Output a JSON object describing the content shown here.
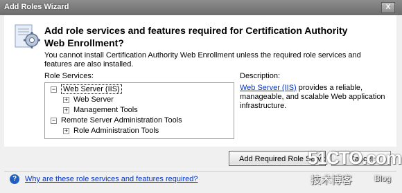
{
  "window": {
    "title": "Add Roles Wizard",
    "close_glyph": "X"
  },
  "header": {
    "icon": "wizard-gear-icon",
    "heading": "Add role services and features required for Certification Authority Web Enrollment?"
  },
  "intro_text": "You cannot install Certification Authority Web Enrollment unless the required role services and features are also installed.",
  "role_services": {
    "label": "Role Services:",
    "tree": [
      {
        "label": "Web Server (IIS)",
        "expander": "−",
        "selected": true
      },
      {
        "label": "Web Server",
        "expander": "+"
      },
      {
        "label": "Management Tools",
        "expander": "+"
      },
      {
        "label": "Remote Server Administration Tools",
        "expander": "−"
      },
      {
        "label": "Role Administration Tools",
        "expander": "+"
      }
    ]
  },
  "description": {
    "label": "Description:",
    "link_text": "Web Server (IIS)",
    "text": " provides a reliable, manageable, and scalable Web application infrastructure."
  },
  "buttons": {
    "add_required": "Add Required Role Services",
    "cancel": "Cancel"
  },
  "help": {
    "icon": "help-icon",
    "glyph": "?",
    "link_text": "Why are these role services and features required?"
  },
  "watermark": {
    "main": "51CTO.com",
    "sub": "技术博客",
    "blog": "Blog"
  }
}
